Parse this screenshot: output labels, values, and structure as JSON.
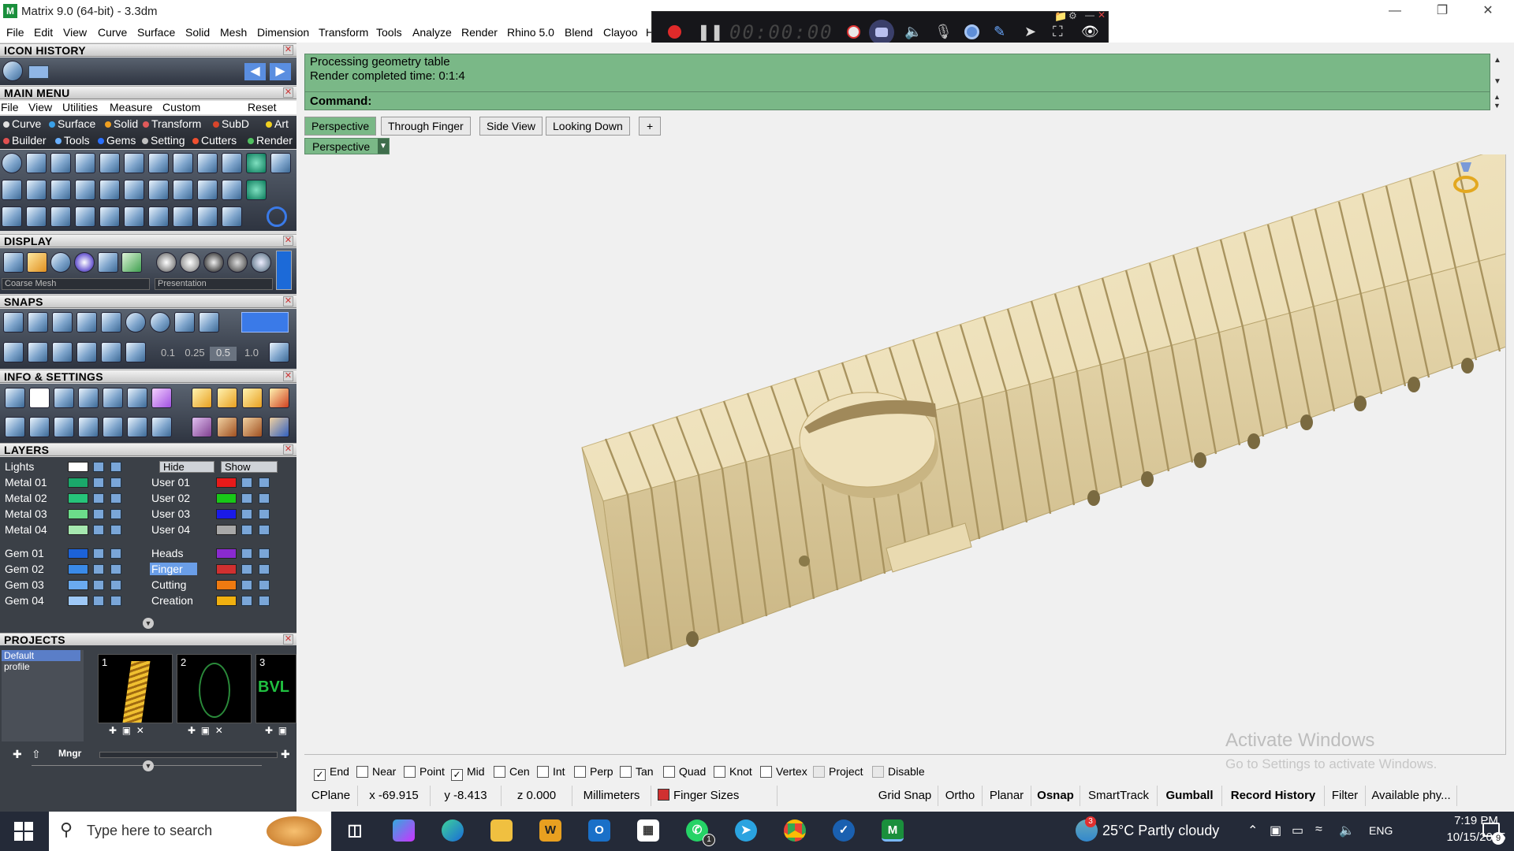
{
  "window": {
    "title": "Matrix 9.0 (64-bit) - 3.3dm",
    "app_icon": "matrix-app-icon"
  },
  "menubar": [
    "File",
    "Edit",
    "View",
    "Curve",
    "Surface",
    "Solid",
    "Mesh",
    "Dimension",
    "Transform",
    "Tools",
    "Analyze",
    "Render",
    "Rhino 5.0",
    "Blend",
    "Clayoo",
    "H"
  ],
  "recorder": {
    "time": "00:00:00"
  },
  "panels": {
    "icon_history": "ICON HISTORY",
    "main_menu": "MAIN MENU",
    "display": "DISPLAY",
    "snaps": "SNAPS",
    "info_settings": "INFO & SETTINGS",
    "layers": "LAYERS",
    "projects": "PROJECTS"
  },
  "main_menu": {
    "items": [
      "File",
      "View",
      "Utilities",
      "Measure",
      "Custom",
      "Reset"
    ],
    "categories_row1": [
      {
        "label": "Curve",
        "color": "#e0e0e0"
      },
      {
        "label": "Surface",
        "color": "#3aa0e8"
      },
      {
        "label": "Solid",
        "color": "#f0a020"
      },
      {
        "label": "Transform",
        "color": "#e05a5a"
      },
      {
        "label": "SubD",
        "color": "#d8452b"
      },
      {
        "label": "Art",
        "color": "#f0d020"
      }
    ],
    "categories_row2": [
      {
        "label": "Builder",
        "color": "#e05050"
      },
      {
        "label": "Tools",
        "color": "#6ab0ff"
      },
      {
        "label": "Gems",
        "color": "#2a70ff"
      },
      {
        "label": "Setting",
        "color": "#c0c0c0"
      },
      {
        "label": "Cutters",
        "color": "#f05030"
      },
      {
        "label": "Render",
        "color": "#50c060"
      }
    ]
  },
  "display": {
    "mesh_select": "Coarse Mesh",
    "mode_select": "Presentation"
  },
  "snaps": {
    "values": [
      "0.1",
      "0.25",
      "0.5",
      "1.0"
    ]
  },
  "layers": {
    "hide": "Hide",
    "show": "Show",
    "left": [
      {
        "name": "Lights",
        "color": "#ffffff"
      },
      {
        "name": "Metal 01",
        "color": "#1aa86a"
      },
      {
        "name": "Metal 02",
        "color": "#26c47a"
      },
      {
        "name": "Metal 03",
        "color": "#6cdc8a"
      },
      {
        "name": "Metal 04",
        "color": "#a6e8b0"
      },
      {
        "name": "Gem 01",
        "color": "#1c62d8"
      },
      {
        "name": "Gem 02",
        "color": "#3a8ae8"
      },
      {
        "name": "Gem 03",
        "color": "#6aaaf0"
      },
      {
        "name": "Gem 04",
        "color": "#9ec8f6"
      }
    ],
    "right": [
      {
        "name": "User 01",
        "color": "#e81a1a"
      },
      {
        "name": "User 02",
        "color": "#18c818"
      },
      {
        "name": "User 03",
        "color": "#1a1ae8"
      },
      {
        "name": "User 04",
        "color": "#a8a8a8"
      },
      {
        "name": "Heads",
        "color": "#8a2ad0"
      },
      {
        "name": "Finger",
        "color": "#d03030"
      },
      {
        "name": "Cutting",
        "color": "#f07a10"
      },
      {
        "name": "Creation",
        "color": "#f0b010"
      }
    ],
    "selected": "Finger"
  },
  "projects": {
    "profile": "Default profile",
    "thumbs": [
      "1",
      "2",
      "3"
    ],
    "thumb3_text": "BVL",
    "mngr": "Mngr"
  },
  "output": {
    "line1": "Processing geometry table",
    "line2": "Render completed time: 0:1:4",
    "command": "Command:"
  },
  "viewport_tabs": [
    "Perspective",
    "Through Finger",
    "Side View",
    "Looking Down",
    "+"
  ],
  "viewport_dropdown": "Perspective",
  "watermark": {
    "title": "Activate Windows",
    "subtitle": "Go to Settings to activate Windows."
  },
  "osnaps": [
    {
      "label": "End",
      "checked": true
    },
    {
      "label": "Near",
      "checked": false
    },
    {
      "label": "Point",
      "checked": false
    },
    {
      "label": "Mid",
      "checked": true
    },
    {
      "label": "Cen",
      "checked": false
    },
    {
      "label": "Int",
      "checked": false
    },
    {
      "label": "Perp",
      "checked": false
    },
    {
      "label": "Tan",
      "checked": false
    },
    {
      "label": "Quad",
      "checked": false
    },
    {
      "label": "Knot",
      "checked": false
    },
    {
      "label": "Vertex",
      "checked": false
    },
    {
      "label": "Project",
      "checked": false
    },
    {
      "label": "Disable",
      "checked": false
    }
  ],
  "status": {
    "cplane": "CPlane",
    "x": "x -69.915",
    "y": "y -8.413",
    "z": "z 0.000",
    "units": "Millimeters",
    "layer": "Finger Sizes",
    "layer_color": "#d03030",
    "grid_snap": "Grid Snap",
    "ortho": "Ortho",
    "planar": "Planar",
    "osnap": "Osnap",
    "smarttrack": "SmartTrack",
    "gumball": "Gumball",
    "record_history": "Record History",
    "filter": "Filter",
    "memory": "Available phy..."
  },
  "taskbar": {
    "search_placeholder": "Type here to search",
    "weather_badge": "3",
    "weather": "25°C  Partly cloudy",
    "lang": "ENG",
    "time": "7:19 PM",
    "date": "10/15/2025",
    "notifications": "9",
    "whatsapp_badge": "1"
  }
}
